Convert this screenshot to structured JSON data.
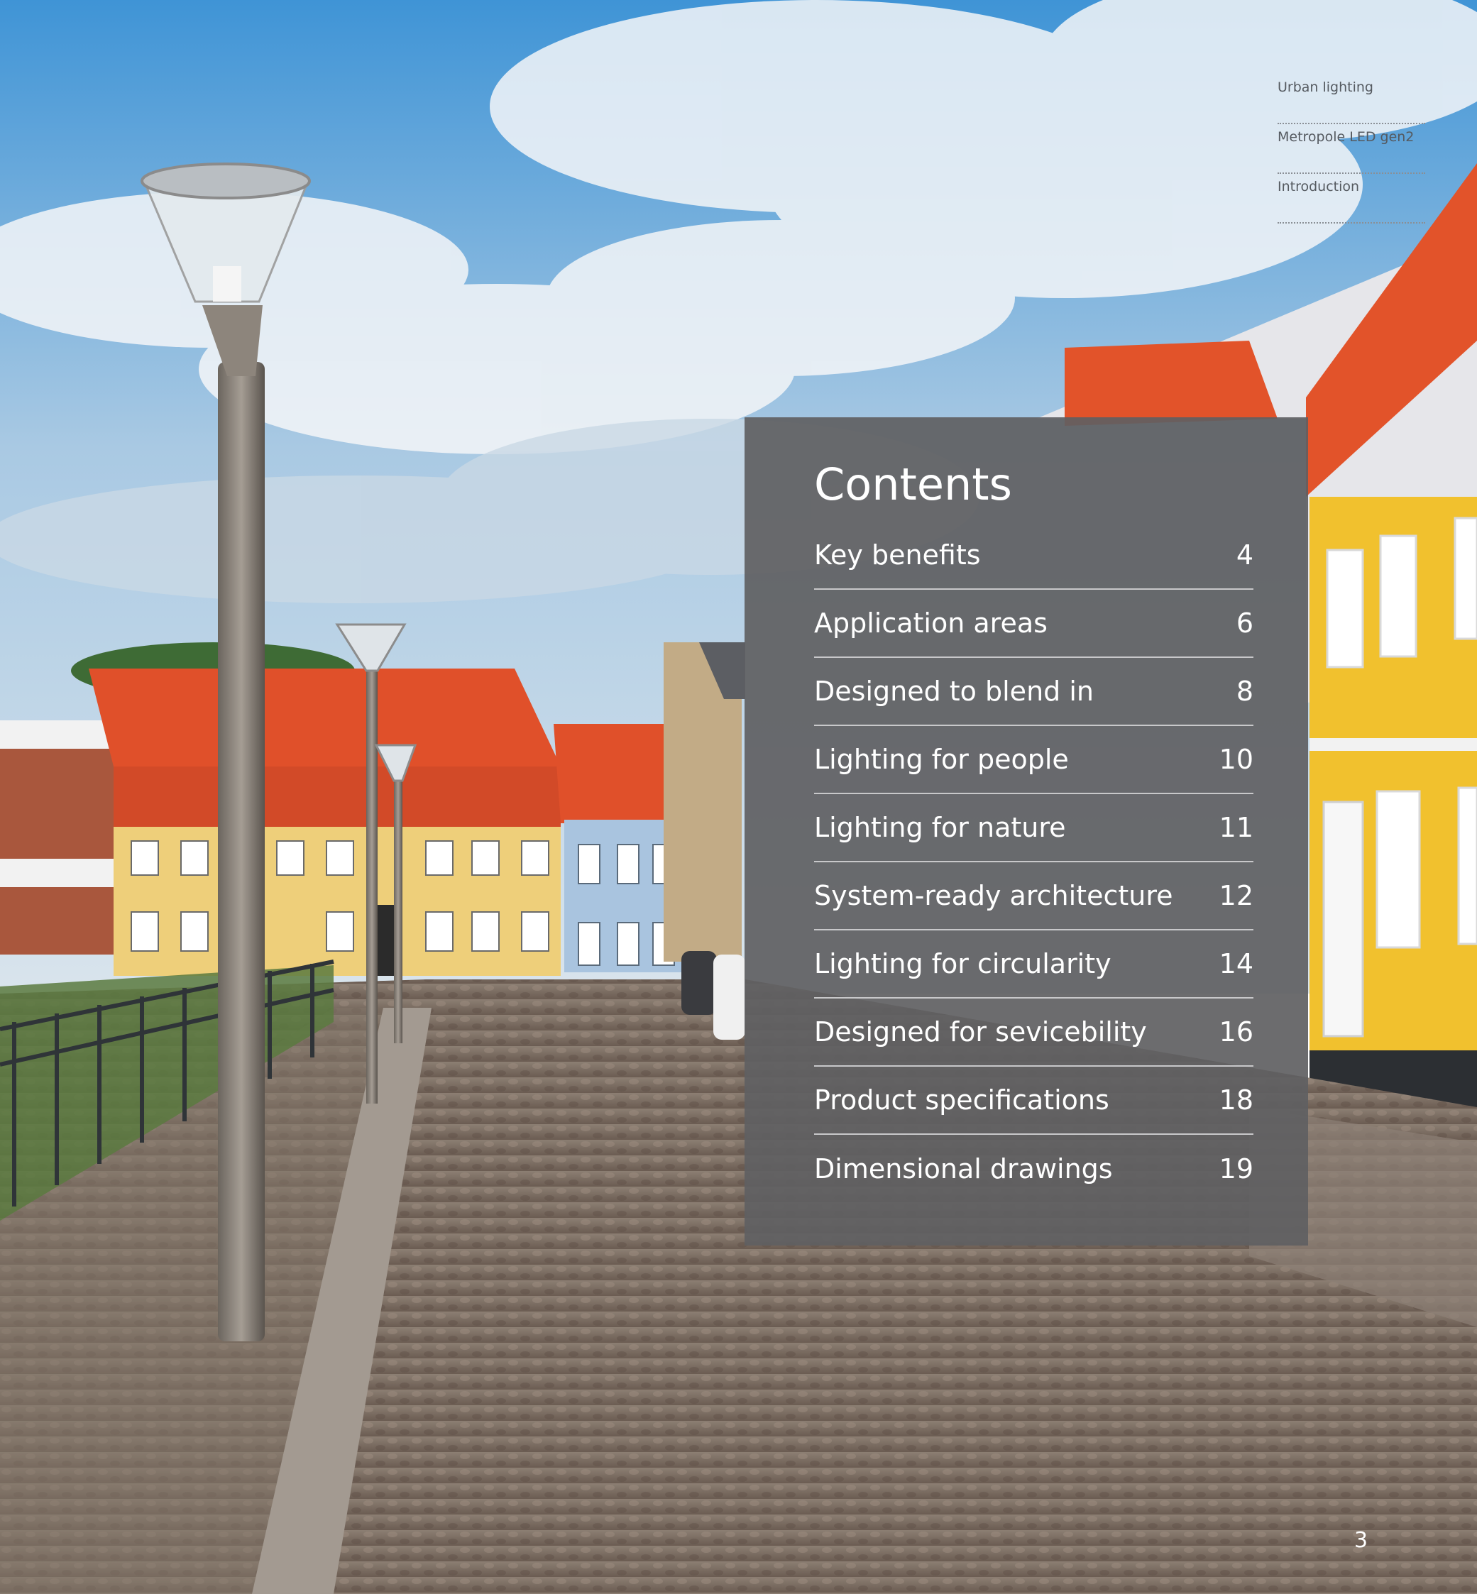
{
  "breadcrumb": [
    {
      "label": "Urban lighting"
    },
    {
      "label": "Metropole LED gen2"
    },
    {
      "label": "Introduction"
    }
  ],
  "contents": {
    "title": "Contents",
    "items": [
      {
        "label": "Key benefits",
        "page": "4"
      },
      {
        "label": "Application areas",
        "page": "6"
      },
      {
        "label": "Designed to blend in",
        "page": "8"
      },
      {
        "label": "Lighting for people",
        "page": "10"
      },
      {
        "label": "Lighting for nature",
        "page": "11"
      },
      {
        "label": "System-ready architecture",
        "page": "12"
      },
      {
        "label": "Lighting for circularity",
        "page": "14"
      },
      {
        "label": "Designed for sevicebility",
        "page": "16"
      },
      {
        "label": "Product specifications",
        "page": "18"
      },
      {
        "label": "Dimensional drawings",
        "page": "19"
      }
    ]
  },
  "page_number": "3",
  "photo": {
    "subject": "cobblestone street with street lamps and colorful houses",
    "colors": {
      "sky": "#5ea3d6",
      "roof": "#e0502a",
      "yellow_house": "#f0c13a",
      "panel": "#606062"
    }
  }
}
